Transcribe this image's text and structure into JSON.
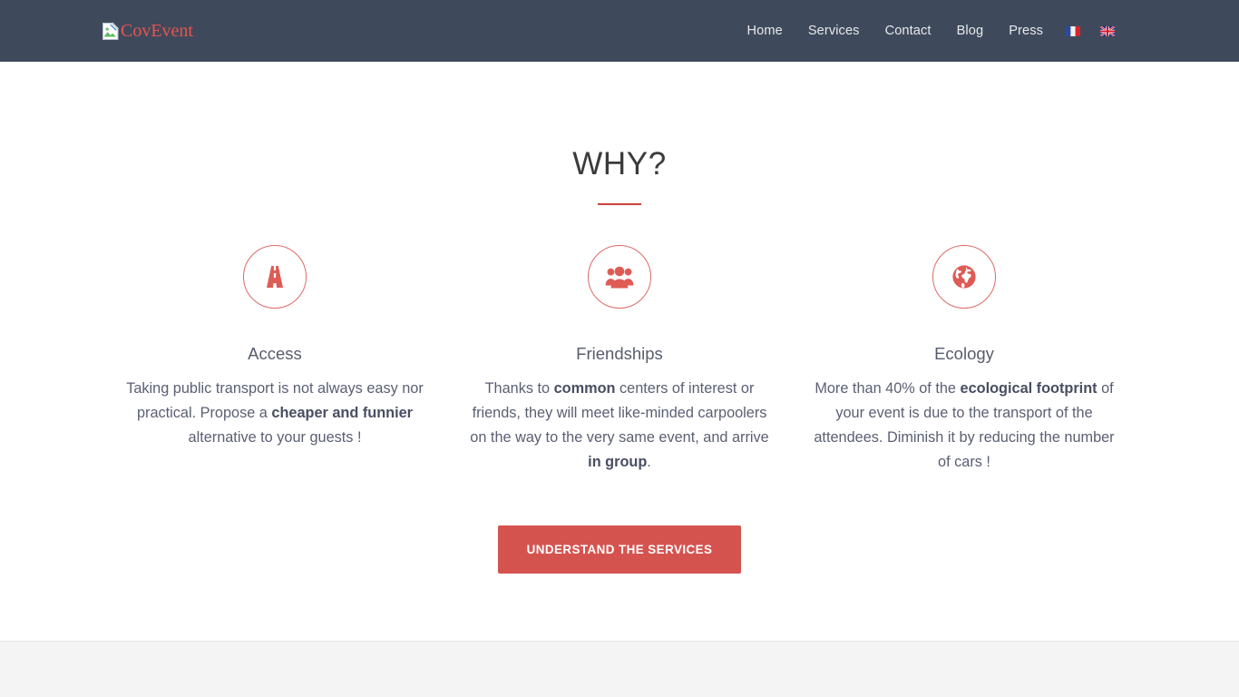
{
  "header": {
    "brand": {
      "alt_text": "CovEvent",
      "icon": "broken-image-icon"
    },
    "nav": [
      {
        "label": "Home",
        "name": "nav-link-home"
      },
      {
        "label": "Services",
        "name": "nav-link-services"
      },
      {
        "label": "Contact",
        "name": "nav-link-contact"
      },
      {
        "label": "Blog",
        "name": "nav-link-blog"
      },
      {
        "label": "Press",
        "name": "nav-link-press"
      }
    ],
    "languages": [
      {
        "label": "Français",
        "icon": "flag-france-icon"
      },
      {
        "label": "English",
        "icon": "flag-united-kingdom-icon"
      }
    ]
  },
  "why": {
    "title": "WHY?",
    "features": [
      {
        "icon": "road-icon",
        "title": "Access",
        "text_parts": [
          {
            "text": "Taking public transport is not always easy nor practical. Propose a ",
            "bold": false
          },
          {
            "text": "cheaper and funnier",
            "bold": true
          },
          {
            "text": " alternative to your guests !",
            "bold": false
          }
        ]
      },
      {
        "icon": "users-icon",
        "title": "Friendships",
        "text_parts": [
          {
            "text": "Thanks to ",
            "bold": false
          },
          {
            "text": "common",
            "bold": true
          },
          {
            "text": " centers of interest or friends, they will meet like-minded carpoolers on the way to the very same event, and arrive ",
            "bold": false
          },
          {
            "text": "in group",
            "bold": true
          },
          {
            "text": ".",
            "bold": false
          }
        ]
      },
      {
        "icon": "globe-icon",
        "title": "Ecology",
        "text_parts": [
          {
            "text": "More than 40% of the ",
            "bold": false
          },
          {
            "text": "ecological footprint",
            "bold": true
          },
          {
            "text": " of your event is due to the transport of the attendees. Diminish it by reducing the number of cars !",
            "bold": false
          }
        ]
      }
    ],
    "cta_label": "UNDERSTAND THE SERVICES"
  },
  "colors": {
    "header_background": "#3e4a5c",
    "accent_red": "#d5534f",
    "icon_outline": "#dd6a66",
    "title_rule": "#c9413f",
    "body_text": "#5a5f73",
    "lower_band": "#f4f4f4"
  }
}
